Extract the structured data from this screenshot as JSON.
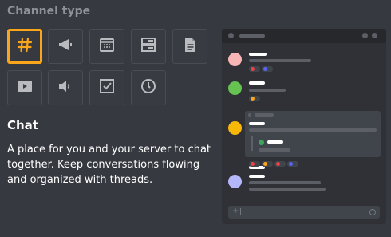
{
  "section_title": "Channel type",
  "channel_types": [
    {
      "name": "text-channel",
      "icon": "hash-icon",
      "selected": true
    },
    {
      "name": "announcement-channel",
      "icon": "megaphone-icon",
      "selected": false
    },
    {
      "name": "event-channel",
      "icon": "calendar-icon",
      "selected": false
    },
    {
      "name": "directory-channel",
      "icon": "directory-icon",
      "selected": false
    },
    {
      "name": "document-channel",
      "icon": "document-icon",
      "selected": false
    },
    {
      "name": "video-channel",
      "icon": "play-icon",
      "selected": false
    },
    {
      "name": "voice-channel",
      "icon": "speaker-icon",
      "selected": false
    },
    {
      "name": "task-channel",
      "icon": "checkbox-icon",
      "selected": false
    },
    {
      "name": "schedule-channel",
      "icon": "clock-icon",
      "selected": false
    }
  ],
  "selected_type": {
    "title": "Chat",
    "description": "A place for you and your server to chat together. Keep conversations flowing and organized with threads."
  },
  "colors": {
    "background": "#36393f",
    "selected_border": "#faa61a",
    "avatar_pink": "#f7b5b6",
    "avatar_green": "#66c251",
    "avatar_yellow": "#f8b807",
    "avatar_lavender": "#b5b7fb",
    "reaction_red": "#ed4245",
    "reaction_blue": "#5865f2",
    "reaction_yellow": "#faa61a"
  }
}
